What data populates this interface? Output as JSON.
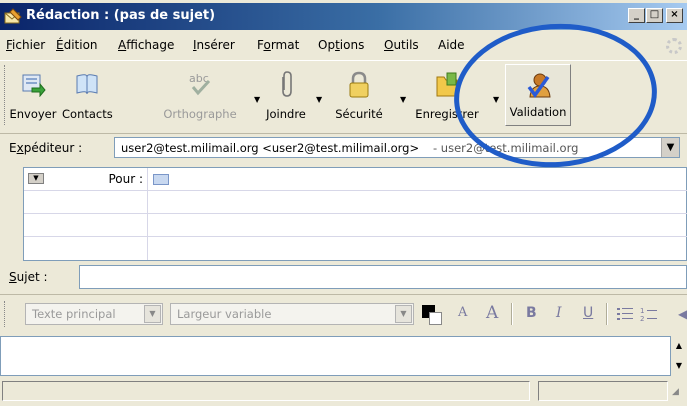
{
  "window": {
    "title": "Rédaction : (pas de sujet)",
    "min": "_",
    "max": "□",
    "close": "×"
  },
  "menu": {
    "fichier": {
      "key": "F",
      "rest": "ichier"
    },
    "edition": {
      "key": "É",
      "rest": "dition"
    },
    "affichage": {
      "key": "A",
      "rest": "ffichage"
    },
    "inserer": {
      "key": "I",
      "rest": "nsérer"
    },
    "format": {
      "pre": "F",
      "key": "o",
      "rest": "rmat"
    },
    "options": {
      "pre": "Op",
      "key": "t",
      "rest": "ions"
    },
    "outils": {
      "key": "O",
      "rest": "utils"
    },
    "aide": {
      "text": "Aide"
    }
  },
  "toolbar": {
    "envoyer": "Envoyer",
    "contacts": "Contacts",
    "orthographe": "Orthographe",
    "joindre": "Joindre",
    "securite": "Sécurité",
    "enregistrer": "Enregistrer",
    "validation": "Validation"
  },
  "sender": {
    "label_key": "x",
    "label_pre": "E",
    "label_rest": "péditeur :",
    "value": "user2@test.milimail.org <user2@test.milimail.org>",
    "suffix": " - user2@test.milimail.org"
  },
  "recipients": {
    "pour_label": "Pour :"
  },
  "subject": {
    "label_key": "S",
    "label_rest": "ujet :"
  },
  "format": {
    "paragraph_style": "Texte principal",
    "font_width": "Largeur variable",
    "bold": "B",
    "italic": "I",
    "underline": "U",
    "smaller": "A",
    "larger": "A"
  },
  "colors": {
    "annotation": "#1f5cc8",
    "titlebar": "#0a246a"
  },
  "icons": [
    "send-icon",
    "contacts-icon",
    "spelling-icon",
    "paperclip-icon",
    "lock-icon",
    "save-icon",
    "validation-icon",
    "address-card-icon",
    "bulleted-list-icon",
    "numbered-list-icon"
  ]
}
